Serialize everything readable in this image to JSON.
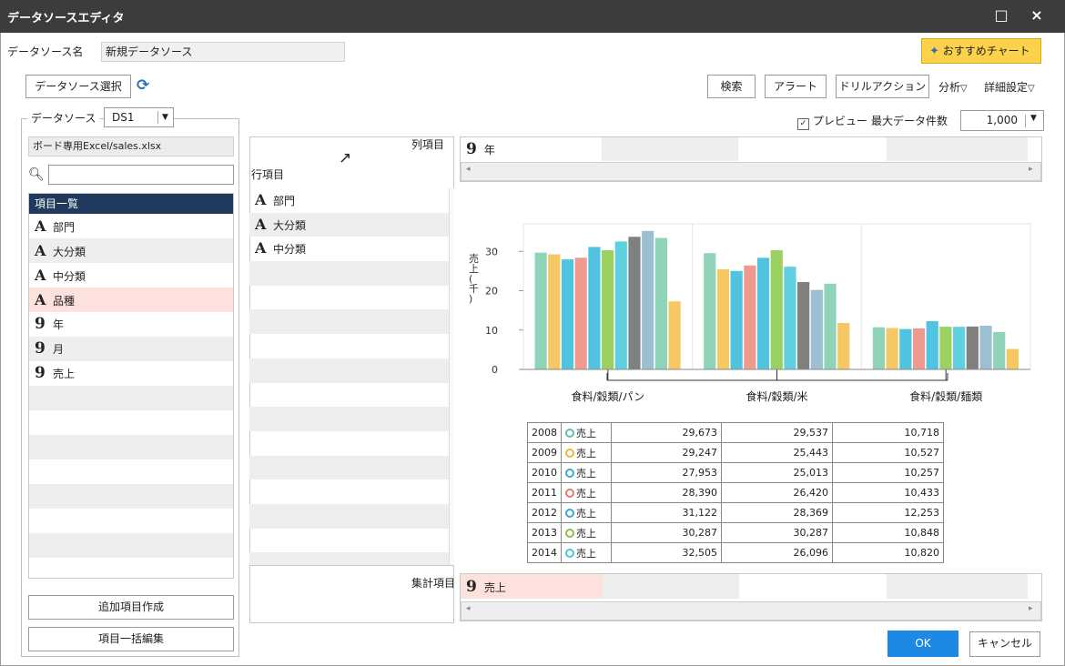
{
  "window": {
    "title": "データソースエディタ",
    "maximize_glyph": "□",
    "close_glyph": "×"
  },
  "datasource_name": {
    "label": "データソース名",
    "value": "新規データソース"
  },
  "recommended_chart": {
    "label": "おすすめチャート",
    "icon": "wand-icon"
  },
  "datasource_select": {
    "label": "データソース選択",
    "icon": "refresh-icon"
  },
  "toolbar": {
    "search": "検索",
    "alert": "アラート",
    "drill": "ドリルアクション",
    "analysis": "分析",
    "detail": "詳細設定",
    "dropdown_glyph": "▽"
  },
  "left_panel": {
    "group_label": "データソース",
    "ds_select": "DS1",
    "file_path": "ボード専用Excel/sales.xlsx",
    "search_placeholder": "",
    "list_header": "項目一覧",
    "items": [
      {
        "type": "text",
        "label": "部門"
      },
      {
        "type": "text",
        "label": "大分類"
      },
      {
        "type": "text",
        "label": "中分類"
      },
      {
        "type": "text",
        "label": "品種"
      },
      {
        "type": "number",
        "label": "年"
      },
      {
        "type": "number",
        "label": "月"
      },
      {
        "type": "number",
        "label": "売上"
      }
    ],
    "add_item": "追加項目作成",
    "bulk_edit": "項目一括編集"
  },
  "preview": {
    "checkbox_label": "プレビュー",
    "checked": true,
    "max_label": "最大データ件数",
    "max_value": "1,000"
  },
  "pivot": {
    "column_label": "列項目",
    "row_label": "行項目",
    "measure_label": "集計項目",
    "column_fields": [
      {
        "type": "number",
        "label": "年"
      }
    ],
    "row_fields": [
      {
        "type": "text",
        "label": "部門"
      },
      {
        "type": "text",
        "label": "大分類"
      },
      {
        "type": "text",
        "label": "中分類"
      }
    ],
    "measure_fields": [
      {
        "type": "number",
        "label": "売上"
      }
    ]
  },
  "chart_data": {
    "type": "bar",
    "ylabel": "売上(千)",
    "ylim": [
      0,
      37
    ],
    "yticks": [
      0,
      10,
      20,
      30
    ],
    "grid": false,
    "categories": [
      "食料/穀類/パン",
      "食料/穀類/米",
      "食料/穀類/麺類"
    ],
    "series": [
      {
        "name": "2008",
        "color": "#8fd3b8",
        "values": [
          29.673,
          29.537,
          10.718
        ]
      },
      {
        "name": "2009",
        "color": "#f5c863",
        "values": [
          29.247,
          25.443,
          10.527
        ]
      },
      {
        "name": "2010",
        "color": "#4fc3e0",
        "values": [
          27.953,
          25.013,
          10.257
        ]
      },
      {
        "name": "2011",
        "color": "#ef9a8f",
        "values": [
          28.39,
          26.42,
          10.433
        ]
      },
      {
        "name": "2012",
        "color": "#4fc3e0",
        "values": [
          31.122,
          28.369,
          12.253
        ]
      },
      {
        "name": "2013",
        "color": "#9bd160",
        "values": [
          30.287,
          30.287,
          10.848
        ]
      },
      {
        "name": "2014",
        "color": "#5fd0df",
        "values": [
          32.505,
          26.096,
          10.82
        ]
      },
      {
        "name": "",
        "color": "#808080",
        "values": [
          33.7,
          22.2,
          10.9
        ]
      },
      {
        "name": "",
        "color": "#9dbfd4",
        "values": [
          35.2,
          20.2,
          11.1
        ]
      },
      {
        "name": "",
        "color": "#8fd3b8",
        "values": [
          33.4,
          21.8,
          9.5
        ]
      },
      {
        "name": "",
        "color": "#f5c863",
        "values": [
          17.3,
          11.8,
          5.2
        ]
      }
    ]
  },
  "table": {
    "measure": "売上",
    "rows": [
      {
        "year": "2008",
        "color": "#5cc0b0",
        "values": [
          "29,673",
          "29,537",
          "10,718"
        ]
      },
      {
        "year": "2009",
        "color": "#f0b43c",
        "values": [
          "29,247",
          "25,443",
          "10,527"
        ]
      },
      {
        "year": "2010",
        "color": "#3aa9d6",
        "values": [
          "27,953",
          "25,013",
          "10,257"
        ]
      },
      {
        "year": "2011",
        "color": "#e8756a",
        "values": [
          "28,390",
          "26,420",
          "10,433"
        ]
      },
      {
        "year": "2012",
        "color": "#3aa9d6",
        "values": [
          "31,122",
          "28,369",
          "12,253"
        ]
      },
      {
        "year": "2013",
        "color": "#8cc04a",
        "values": [
          "30,287",
          "30,287",
          "10,848"
        ]
      },
      {
        "year": "2014",
        "color": "#4cc7d6",
        "values": [
          "32,505",
          "26,096",
          "10,820"
        ]
      }
    ]
  },
  "footer": {
    "ok": "OK",
    "cancel": "キャンセル"
  }
}
